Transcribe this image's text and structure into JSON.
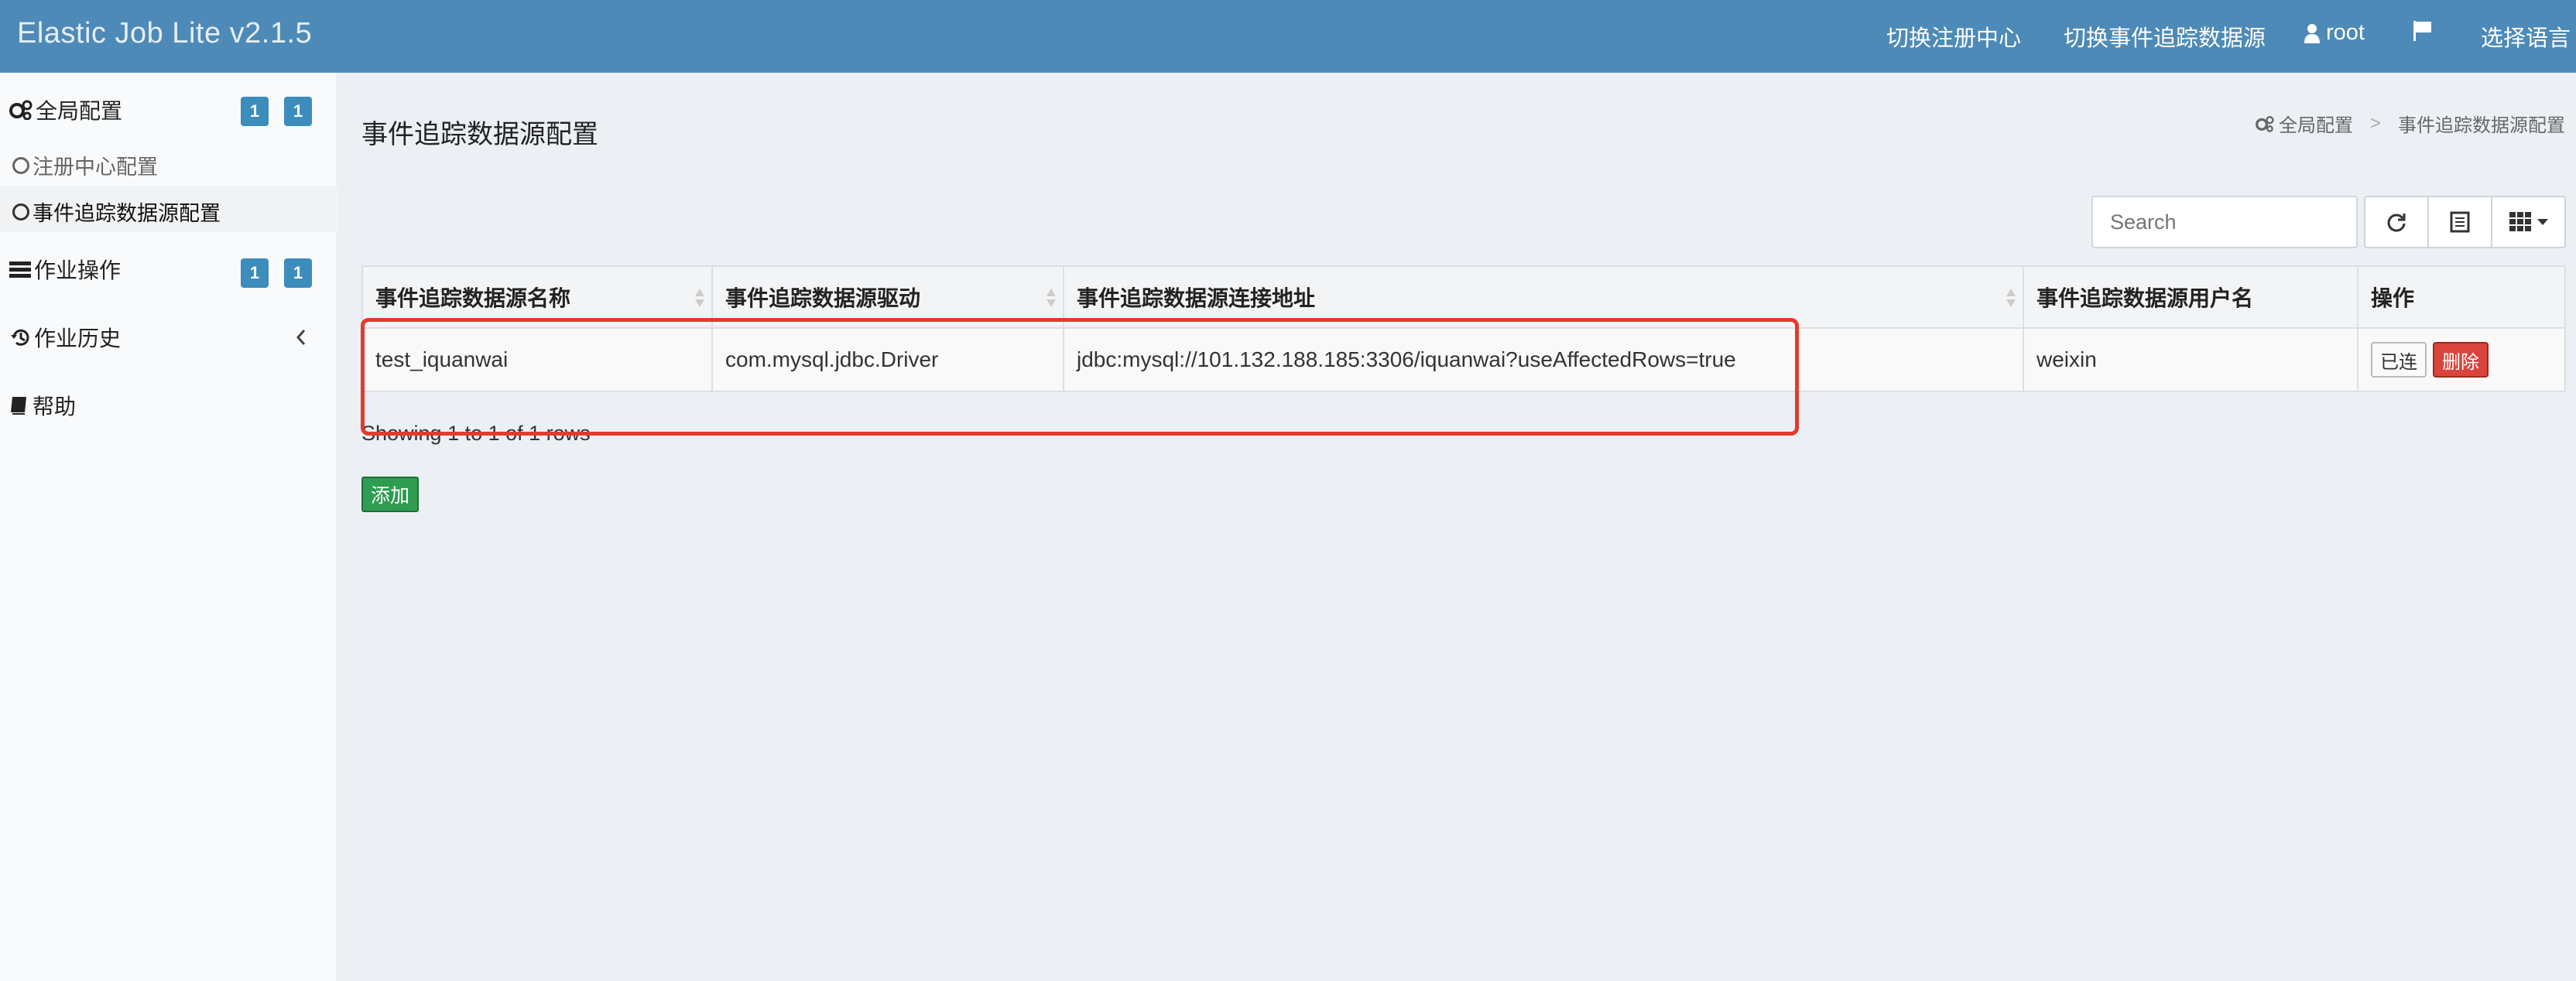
{
  "navbar": {
    "brand": "Elastic Job Lite v2.1.5",
    "switch_registry": "切换注册中心",
    "switch_datasource": "切换事件追踪数据源",
    "user": "root",
    "language": "选择语言",
    "flag_icon": "flag-icon",
    "user_icon": "user-icon"
  },
  "sidebar": {
    "global_config": {
      "label": "全局配置",
      "badge1": "1",
      "badge2": "1",
      "icon": "gears-icon"
    },
    "registry_config": "注册中心配置",
    "datasource_config": "事件追踪数据源配置",
    "job_ops": {
      "label": "作业操作",
      "badge1": "1",
      "badge2": "1",
      "icon": "tasks-icon"
    },
    "job_history": {
      "label": "作业历史",
      "icon": "history-icon"
    },
    "help": {
      "label": "帮助",
      "icon": "book-icon"
    }
  },
  "page": {
    "title": "事件追踪数据源配置",
    "breadcrumb": {
      "root": "全局配置",
      "separator": ">",
      "current": "事件追踪数据源配置"
    }
  },
  "toolbar": {
    "search_placeholder": "Search",
    "refresh_icon": "refresh-icon",
    "toggle_icon": "list-icon",
    "columns_icon": "grid-icon"
  },
  "table": {
    "headers": [
      "事件追踪数据源名称",
      "事件追踪数据源驱动",
      "事件追踪数据源连接地址",
      "事件追踪数据源用户名",
      "操作"
    ],
    "rows": [
      {
        "name": "test_iquanwai",
        "driver": "com.mysql.jdbc.Driver",
        "url": "jdbc:mysql://101.132.188.185:3306/iquanwai?useAffectedRows=true",
        "username": "weixin",
        "connect_label": "已连",
        "delete_label": "删除"
      }
    ]
  },
  "footer": {
    "showing": "Showing 1 to 1 of 1 rows",
    "add_label": "添加"
  },
  "colors": {
    "navbar": "#4e8ab7",
    "badge": "#3c8dbc",
    "danger": "#d9453a",
    "success": "#2e9d51",
    "highlight": "#e23b2e"
  }
}
